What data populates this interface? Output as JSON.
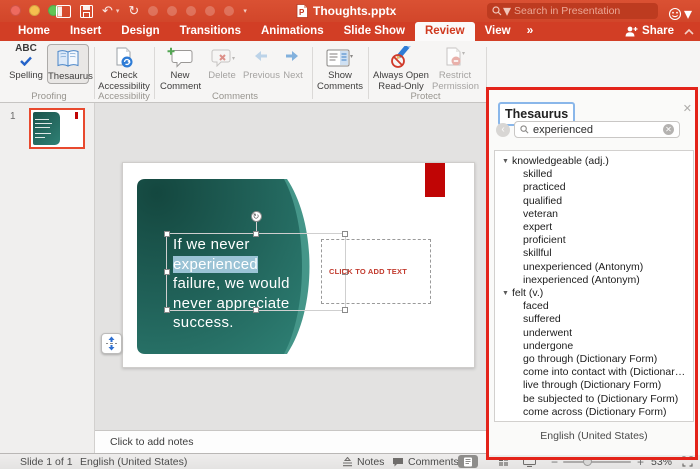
{
  "titlebar": {
    "title": "Thoughts.pptx",
    "search_placeholder": "Search in Presentation"
  },
  "tab_bar": {
    "tabs": [
      {
        "label": "Home",
        "active": false
      },
      {
        "label": "Insert",
        "active": false
      },
      {
        "label": "Design",
        "active": false
      },
      {
        "label": "Transitions",
        "active": false
      },
      {
        "label": "Animations",
        "active": false
      },
      {
        "label": "Slide Show",
        "active": false
      },
      {
        "label": "Review",
        "active": true
      },
      {
        "label": "View",
        "active": false
      }
    ],
    "overflow_chevron": "»",
    "share_label": "Share"
  },
  "ribbon": {
    "spelling": "Spelling",
    "thesaurus": "Thesaurus",
    "proofing_group": "Proofing",
    "check_accessibility": "Check Accessibility",
    "accessibility_group": "Accessibility",
    "new_comment": "New Comment",
    "delete": "Delete",
    "previous": "Previous",
    "next": "Next",
    "show_comments": "Show Comments",
    "comments_group": "Comments",
    "always_open_read_only": "Always Open Read-Only",
    "restrict_permission": "Restrict Permission",
    "protect_group": "Protect"
  },
  "thumbnail_panel": {
    "slide_number": "1"
  },
  "slide": {
    "text_lines": [
      "If we never",
      "experienced",
      "failure, we would",
      "never appreciate",
      "success."
    ],
    "selected_word": "experienced",
    "content_placeholder": "CLICK TO ADD TEXT"
  },
  "notes": {
    "placeholder": "Click to add notes"
  },
  "thesaurus_pane": {
    "title": "Thesaurus",
    "search_value": "experienced",
    "sections": [
      {
        "header": "knowledgeable (adj.)",
        "items": [
          "skilled",
          "practiced",
          "qualified",
          "veteran",
          "expert",
          "proficient",
          "skillful",
          "unexperienced (Antonym)",
          "inexperienced (Antonym)"
        ]
      },
      {
        "header": "felt (v.)",
        "items": [
          "faced",
          "suffered",
          "underwent",
          "undergone",
          "go through (Dictionary Form)",
          "come into contact with (Dictionar…",
          "live through (Dictionary Form)",
          "be subjected to (Dictionary Form)",
          "come across (Dictionary Form)"
        ]
      }
    ],
    "footer_language": "English (United States)"
  },
  "status_bar": {
    "slide_counter": "Slide 1 of 1",
    "language": "English (United States)",
    "notes_label": "Notes",
    "comments_label": "Comments",
    "zoom_level": "53%"
  },
  "icons": {
    "undo_glyph": "↶",
    "redo_glyph": "↻",
    "dropdown_glyph": "▾",
    "disclosure_glyph": "▼",
    "back_glyph": "‹",
    "close_glyph": "✕",
    "rotate_glyph": "↻",
    "minus_glyph": "−",
    "plus_glyph": "+"
  },
  "colors": {
    "accent_red": "#d2462a",
    "annotation_red": "#e3231a",
    "slide_teal_dark": "#1b524b",
    "slide_teal_light": "#2f8175",
    "shape_red": "#c00505",
    "placeholder_text_red": "#c23b2e",
    "selection_highlight": "#a8cee3"
  }
}
